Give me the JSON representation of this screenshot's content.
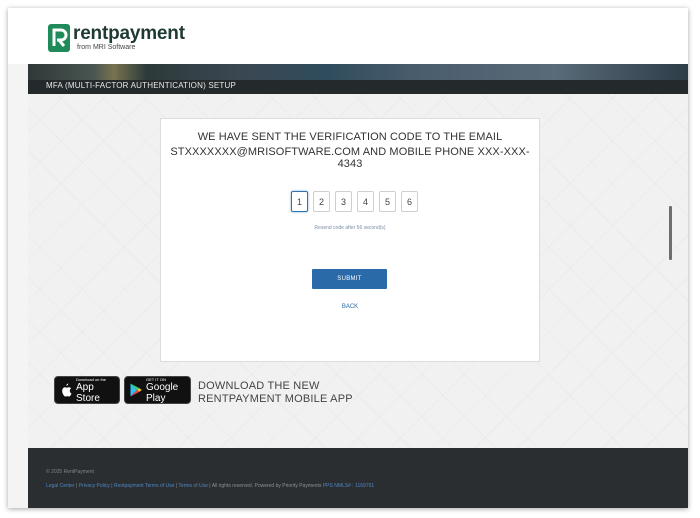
{
  "brand": {
    "name": "rentpayment",
    "sub": "from MRI Software",
    "color": "#1f8a5a"
  },
  "page": {
    "title": "MFA (MULTI-FACTOR AUTHENTICATION) SETUP"
  },
  "verification": {
    "line1": "WE HAVE SENT THE VERIFICATION CODE TO THE EMAIL",
    "line2": "STXXXXXXX@MRISOFTWARE.COM AND MOBILE PHONE XXX-XXX-4343",
    "digits": [
      "1",
      "2",
      "3",
      "4",
      "5",
      "6"
    ],
    "resend": "Resend code after 56 second(s)",
    "submit_label": "SUBMIT",
    "back_label": "BACK"
  },
  "apps": {
    "appstore_small": "Download on the",
    "appstore_big": "App Store",
    "gplay_small": "GET IT ON",
    "gplay_big": "Google Play",
    "line1": "DOWNLOAD THE NEW",
    "line2": "RENTPAYMENT MOBILE APP"
  },
  "footer": {
    "copyright": "© 2025 RentPayment",
    "legal_center": "Legal Center",
    "privacy_policy": "Privacy Policy",
    "rp_terms": "Rentpayment Terms of Use",
    "terms": "Terms of Use",
    "rights": "All rights reserved. Powered by Priority Payments",
    "pps": "PPS NMLS# : 1169701",
    "sep": " | "
  },
  "colors": {
    "accent": "#2a6aa8",
    "footer_bg": "#2b2e30",
    "bar_bg": "#242a2c"
  },
  "icons": [
    "rentpayment-logo-icon",
    "apple-icon",
    "google-play-icon"
  ]
}
